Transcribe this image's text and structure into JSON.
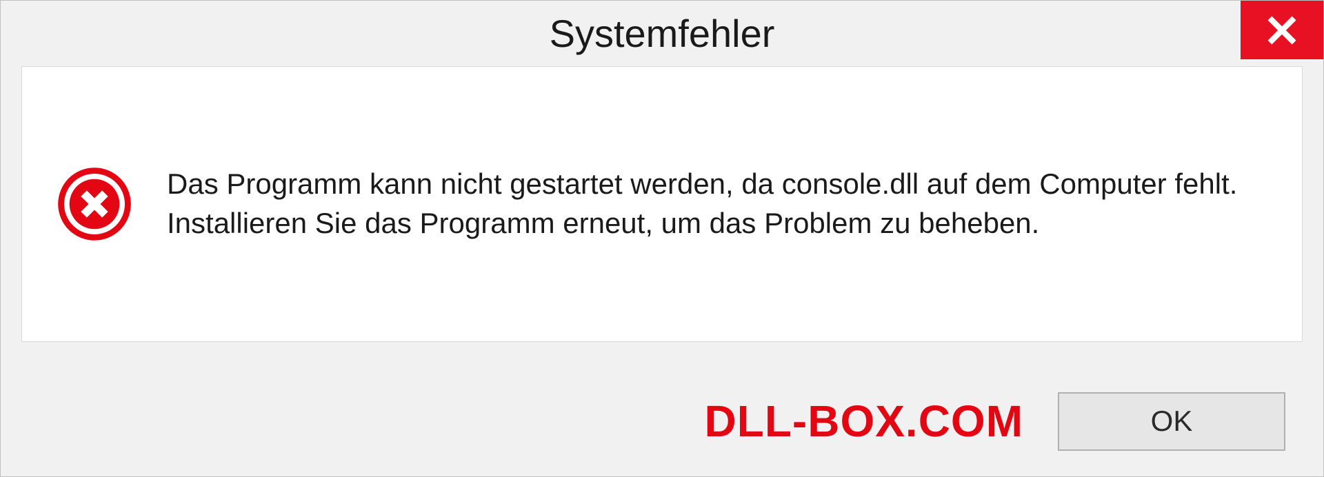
{
  "dialog": {
    "title": "Systemfehler",
    "message": "Das Programm kann nicht gestartet werden, da console.dll auf dem Computer fehlt. Installieren Sie das Programm erneut, um das Problem zu beheben.",
    "ok_label": "OK"
  },
  "watermark": {
    "text": "DLL-BOX.COM"
  }
}
